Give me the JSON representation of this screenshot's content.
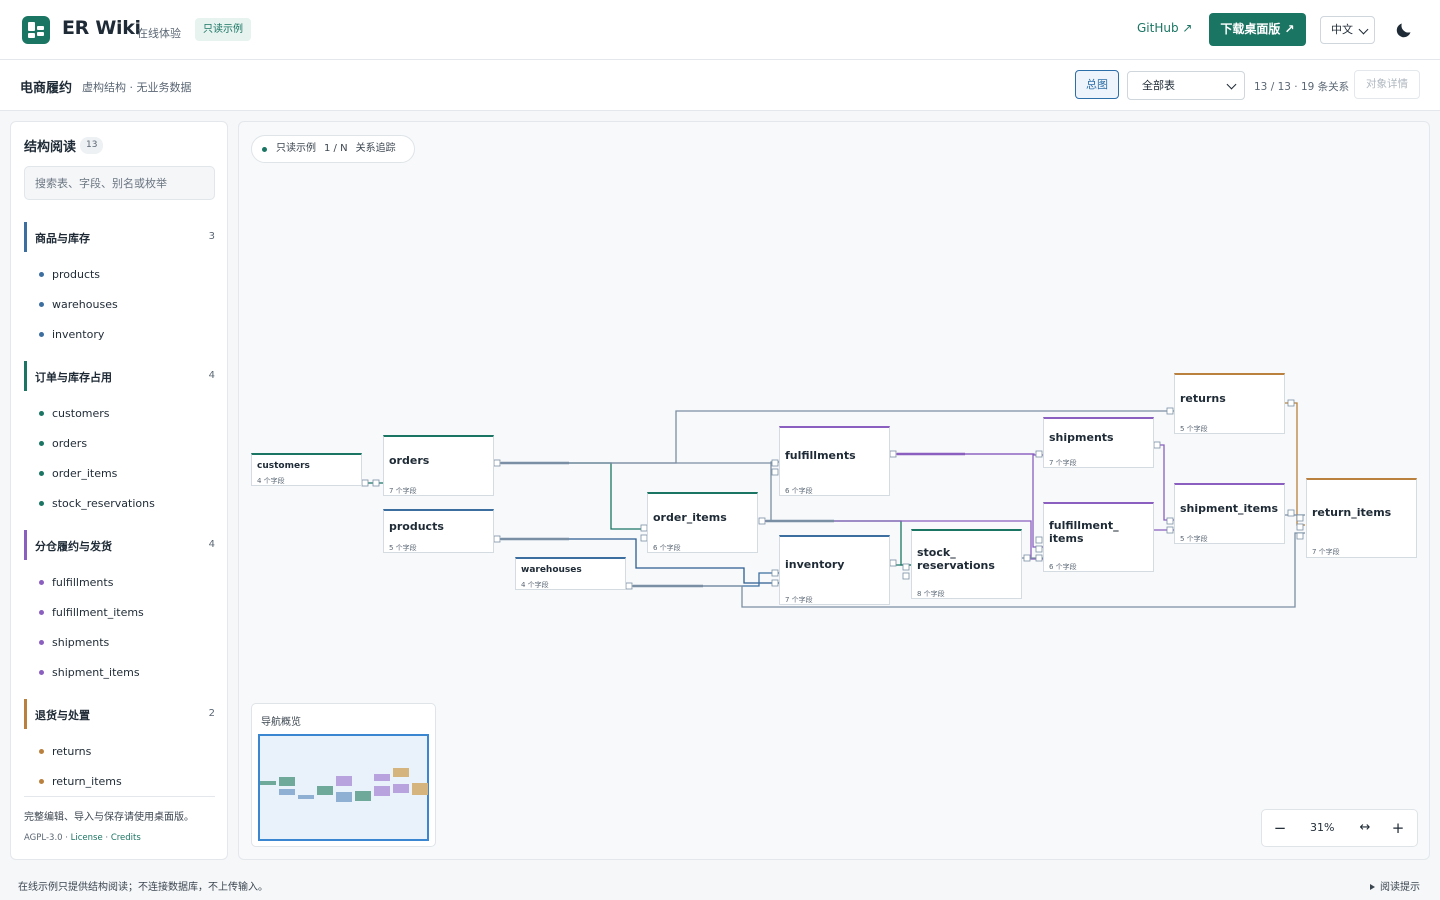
{
  "header": {
    "title": "ER Wiki",
    "subtitle": "在线体验",
    "badge": "只读示例",
    "github_label": "GitHub ↗",
    "download_label": "下载桌面版 ↗",
    "language": "中文",
    "logo_icon": "database-logo-icon",
    "theme_icon": "moon-icon"
  },
  "subheader": {
    "project_title": "电商履约",
    "project_subtitle": "虚构结构 · 无业务数据",
    "overview_label": "总图",
    "table_filter": "全部表",
    "count_text": "13 / 13 · 19 条关系",
    "detail_label": "对象详情"
  },
  "sidebar": {
    "title": "结构阅读",
    "count": "13",
    "search_placeholder": "搜索表、字段、别名或枚举",
    "groups": [
      {
        "label": "商品与库存",
        "count": "3",
        "color": "#3d6ea0",
        "items": [
          "products",
          "warehouses",
          "inventory"
        ]
      },
      {
        "label": "订单与库存占用",
        "count": "4",
        "color": "#1b7563",
        "items": [
          "customers",
          "orders",
          "order_items",
          "stock_reservations"
        ]
      },
      {
        "label": "分仓履约与发货",
        "count": "4",
        "color": "#8a5fbf",
        "items": [
          "fulfillments",
          "fulfillment_items",
          "shipments",
          "shipment_items"
        ]
      },
      {
        "label": "退货与处置",
        "count": "2",
        "color": "#b9813d",
        "items": [
          "returns",
          "return_items"
        ]
      }
    ],
    "footer_note": "完整编辑、导入与保存请使用桌面版。",
    "license_prefix": "AGPL-3.0 · ",
    "license_link": "License",
    "credits_sep": " · ",
    "credits_link": "Credits"
  },
  "canvas": {
    "chip": {
      "mode": "只读示例",
      "cardinality": "1 / N",
      "trace": "关系追踪"
    },
    "nodes": [
      {
        "id": "customers",
        "title": "customers",
        "fields": "4 个字段"
      },
      {
        "id": "orders",
        "title": "orders",
        "fields": "7 个字段"
      },
      {
        "id": "products",
        "title": "products",
        "fields": "5 个字段"
      },
      {
        "id": "warehouses",
        "title": "warehouses",
        "fields": "4 个字段"
      },
      {
        "id": "order_items",
        "title": "order_items",
        "fields": "6 个字段"
      },
      {
        "id": "fulfillments",
        "title": "fulfillments",
        "fields": "6 个字段"
      },
      {
        "id": "inventory",
        "title": "inventory",
        "fields": "7 个字段"
      },
      {
        "id": "stock_reservations",
        "title": "stock_\nreservations",
        "fields": "8 个字段"
      },
      {
        "id": "shipments",
        "title": "shipments",
        "fields": "7 个字段"
      },
      {
        "id": "fulfillment_items",
        "title": "fulfillment_\nitems",
        "fields": "6 个字段"
      },
      {
        "id": "returns",
        "title": "returns",
        "fields": "5 个字段"
      },
      {
        "id": "shipment_items",
        "title": "shipment_items",
        "fields": "5 个字段"
      },
      {
        "id": "return_items",
        "title": "return_items",
        "fields": "7 个字段"
      }
    ],
    "minimap_title": "导航概览",
    "zoom": "31%",
    "zoom_out_icon": "minus-icon",
    "fit_icon": "fit-width-icon",
    "zoom_in_icon": "plus-icon"
  },
  "footer": {
    "left": "在线示例只提供结构阅读；不连接数据库，不上传输入。",
    "right": "阅读提示"
  }
}
